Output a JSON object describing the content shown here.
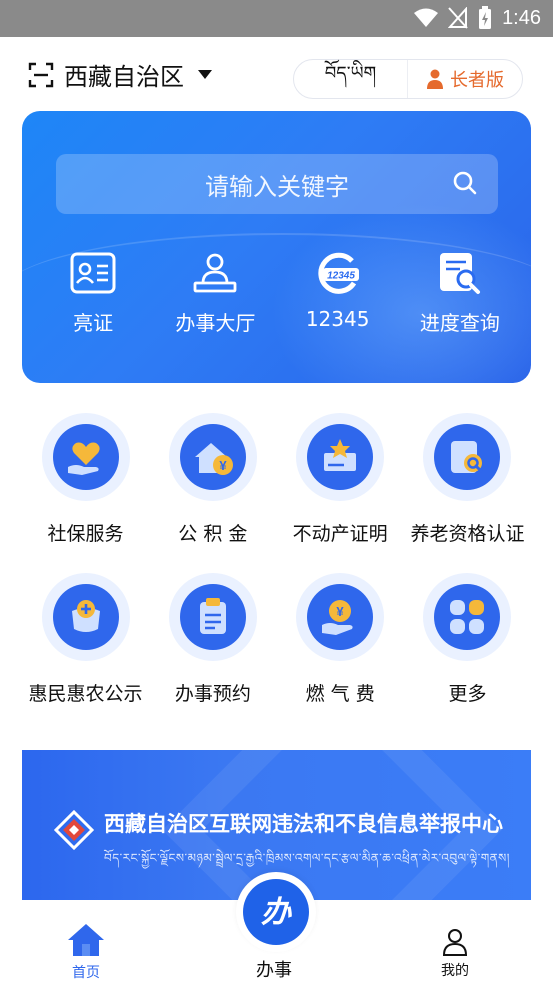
{
  "status_bar": {
    "time": "1:46"
  },
  "header": {
    "region": "西藏自治区",
    "language_label": "བོད་ཡིག",
    "elder_mode_label": "长者版"
  },
  "hero": {
    "search_placeholder": "请输入关键字",
    "quick_actions": [
      {
        "label": "亮证",
        "icon": "id-card-icon"
      },
      {
        "label": "办事大厅",
        "icon": "service-hall-icon"
      },
      {
        "label": "12345",
        "icon": "hotline-12345-icon"
      },
      {
        "label": "进度查询",
        "icon": "progress-search-icon"
      }
    ]
  },
  "services": [
    {
      "label": "社保服务",
      "icon": "heart-hand-icon"
    },
    {
      "label": "公 积 金",
      "icon": "house-yen-icon"
    },
    {
      "label": "不动产证明",
      "icon": "certificate-star-icon"
    },
    {
      "label": "养老资格认证",
      "icon": "document-search-icon"
    },
    {
      "label": "惠民惠农公示",
      "icon": "money-bag-icon"
    },
    {
      "label": "办事预约",
      "icon": "clipboard-icon"
    },
    {
      "label": "燃 气 费",
      "icon": "yen-hand-icon"
    },
    {
      "label": "更多",
      "icon": "more-grid-icon"
    }
  ],
  "banner": {
    "title": "西藏自治区互联网违法和不良信息举报中心",
    "subtitle": "བོད་རང་སྐྱོང་ལྗོངས་མཉམ་སྦྲེལ་དྲ་རྒྱའི་ཁྲིམས་འགལ་དང་རྩལ་མིན་ཆ་འཕྲིན་མེར་འབུལ་ལྟེ་གནས།"
  },
  "bottom_nav": {
    "home_label": "首页",
    "center_label": "办事",
    "center_icon_text": "办",
    "mine_label": "我的"
  },
  "colors": {
    "primary": "#2f67ec",
    "accent_orange": "#e56a2d",
    "yellow": "#f5b83a"
  }
}
